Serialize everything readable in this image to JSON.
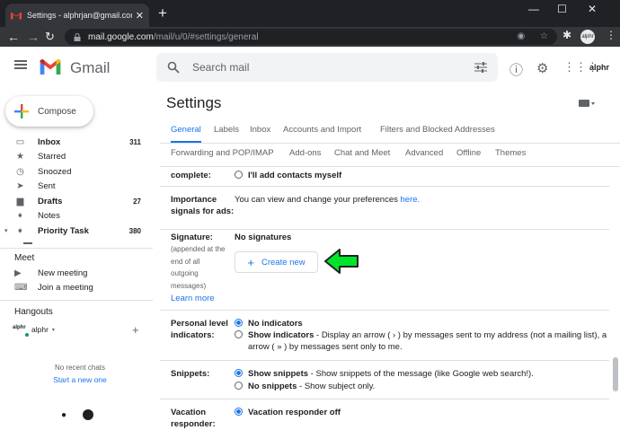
{
  "browser": {
    "tab_title": "Settings - alphrjan@gmail.com -",
    "url_host": "mail.google.com",
    "url_path": "/mail/u/0/#settings/general",
    "profile_text": "alphr",
    "icons": [
      "gmail-favicon",
      "close-icon",
      "new-tab-icon",
      "minimize-icon",
      "maximize-icon",
      "window-close-icon",
      "back-icon",
      "forward-icon",
      "reload-icon",
      "lock-icon",
      "eye-icon",
      "star-icon",
      "extensions-icon",
      "menu-dots-icon"
    ]
  },
  "gmail": {
    "logo_text": "Gmail",
    "search_placeholder": "Search mail",
    "account_logo": "alphr"
  },
  "sidebar": {
    "compose": "Compose",
    "items": [
      {
        "label": "Inbox",
        "count": "311",
        "bold": true,
        "icon": "inbox-icon"
      },
      {
        "label": "Starred",
        "count": "",
        "bold": false,
        "icon": "star-icon"
      },
      {
        "label": "Snoozed",
        "count": "",
        "bold": false,
        "icon": "clock-icon"
      },
      {
        "label": "Sent",
        "count": "",
        "bold": false,
        "icon": "send-icon"
      },
      {
        "label": "Drafts",
        "count": "27",
        "bold": true,
        "icon": "draft-icon"
      },
      {
        "label": "Notes",
        "count": "",
        "bold": false,
        "icon": "label-icon"
      },
      {
        "label": "Priority Task",
        "count": "380",
        "bold": true,
        "icon": "label-icon"
      }
    ],
    "meet_title": "Meet",
    "meet_items": [
      "New meeting",
      "Join a meeting"
    ],
    "hangouts_title": "Hangouts",
    "hangouts_user": "alphr",
    "no_chats": "No recent chats",
    "start_new": "Start a new one"
  },
  "settings": {
    "title": "Settings",
    "tabs_row1": [
      "General",
      "Labels",
      "Inbox",
      "Accounts and Import",
      "Filters and Blocked Addresses"
    ],
    "tabs_row2": [
      "Forwarding and POP/IMAP",
      "Add-ons",
      "Chat and Meet",
      "Advanced",
      "Offline",
      "Themes"
    ],
    "complete_label": "complete:",
    "complete_option": "I'll add contacts myself",
    "importance_label_1": "Importance",
    "importance_label_2": "signals for ads:",
    "importance_text": "You can view and change your preferences",
    "importance_link": "here.",
    "signature_label": "Signature:",
    "signature_sub": [
      "(appended at the",
      "end of all",
      "outgoing",
      "messages)"
    ],
    "learn_more": "Learn more",
    "no_signatures": "No signatures",
    "create_new": "Create new",
    "personal_label_1": "Personal level",
    "personal_label_2": "indicators:",
    "no_indicators": "No indicators",
    "show_indicators": "Show indicators",
    "show_indicators_desc_1": " - Display an arrow ( › ) by messages sent to my address (not a mailing list), a",
    "show_indicators_desc_2": "arrow ( » ) by messages sent only to me.",
    "snippets_label": "Snippets:",
    "show_snippets": "Show snippets",
    "show_snippets_desc": " - Show snippets of the message (like Google web search!).",
    "no_snippets": "No snippets",
    "no_snippets_desc": " - Show subject only.",
    "vacation_label_1": "Vacation",
    "vacation_label_2": "responder:",
    "vacation_off": "Vacation responder off"
  },
  "colors": {
    "accent": "#1a73e8",
    "highlight_arrow": "#00e52b"
  }
}
